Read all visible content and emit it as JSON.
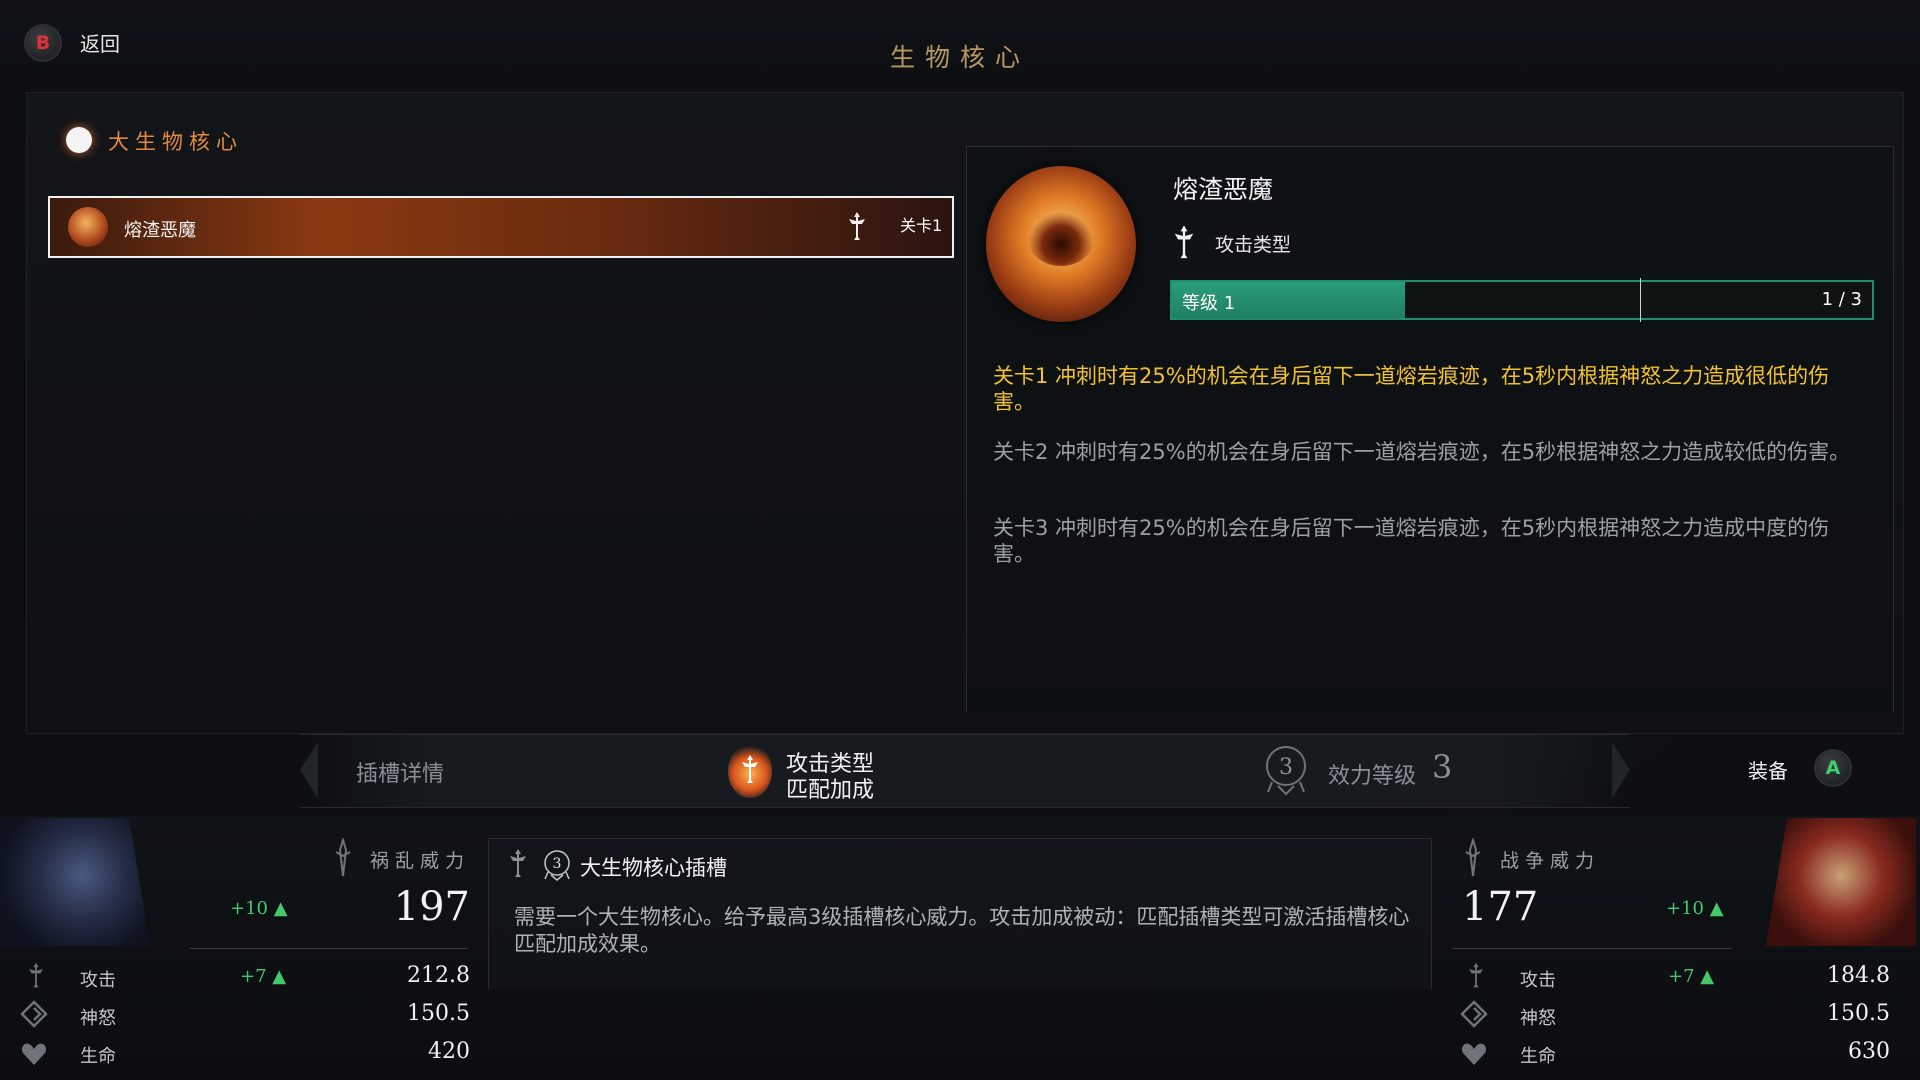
{
  "header": {
    "back_button": "B",
    "back_label": "返回",
    "title": "生物核心"
  },
  "category": {
    "title": "大生物核心"
  },
  "core_list": [
    {
      "name": "熔渣恶魔",
      "type_icon": "attack-type-icon",
      "level": "关卡1"
    }
  ],
  "detail": {
    "name": "熔渣恶魔",
    "type_label": "攻击类型",
    "level_label": "等级 1",
    "level_progress": "1 / 3",
    "level_fraction": 0.333,
    "tiers": [
      "关卡1 冲刺时有25%的机会在身后留下一道熔岩痕迹，在5秒内根据神怒之力造成很低的伤害。",
      "关卡2 冲刺时有25%的机会在身后留下一道熔岩痕迹，在5秒根据神怒之力造成较低的伤害。",
      "关卡3 冲刺时有25%的机会在身后留下一道熔岩痕迹，在5秒内根据神怒之力造成中度的伤害。"
    ]
  },
  "socket_bar": {
    "details_label": "插槽详情",
    "match_line1": "攻击类型",
    "match_line2": "匹配加成",
    "potency_label": "效力等级",
    "potency_value": "3",
    "equip_label": "装备",
    "equip_button": "A"
  },
  "socket_box": {
    "title": "大生物核心插槽",
    "description": "需要一个大生物核心。给予最高3级插槽核心威力。攻击加成被动：匹配插槽类型可激活插槽核心匹配加成效果。"
  },
  "left_stats": {
    "power_label": "祸乱威力",
    "power_bonus": "+10 ▲",
    "power_value": "197",
    "rows": [
      {
        "label": "攻击",
        "bonus": "+7 ▲",
        "value": "212.8"
      },
      {
        "label": "神怒",
        "bonus": "",
        "value": "150.5"
      },
      {
        "label": "生命",
        "bonus": "",
        "value": "420"
      }
    ]
  },
  "right_stats": {
    "power_label": "战争威力",
    "power_bonus": "+10 ▲",
    "power_value": "177",
    "rows": [
      {
        "label": "攻击",
        "bonus": "+7 ▲",
        "value": "184.8"
      },
      {
        "label": "神怒",
        "bonus": "",
        "value": "150.5"
      },
      {
        "label": "生命",
        "bonus": "",
        "value": "630"
      }
    ]
  },
  "colors": {
    "accent_orange": "#e08b3f",
    "title_gold": "#b6995e",
    "tier_active": "#f2c12e",
    "level_bar": "#2a9e7a",
    "bonus_green": "#46c86a"
  }
}
